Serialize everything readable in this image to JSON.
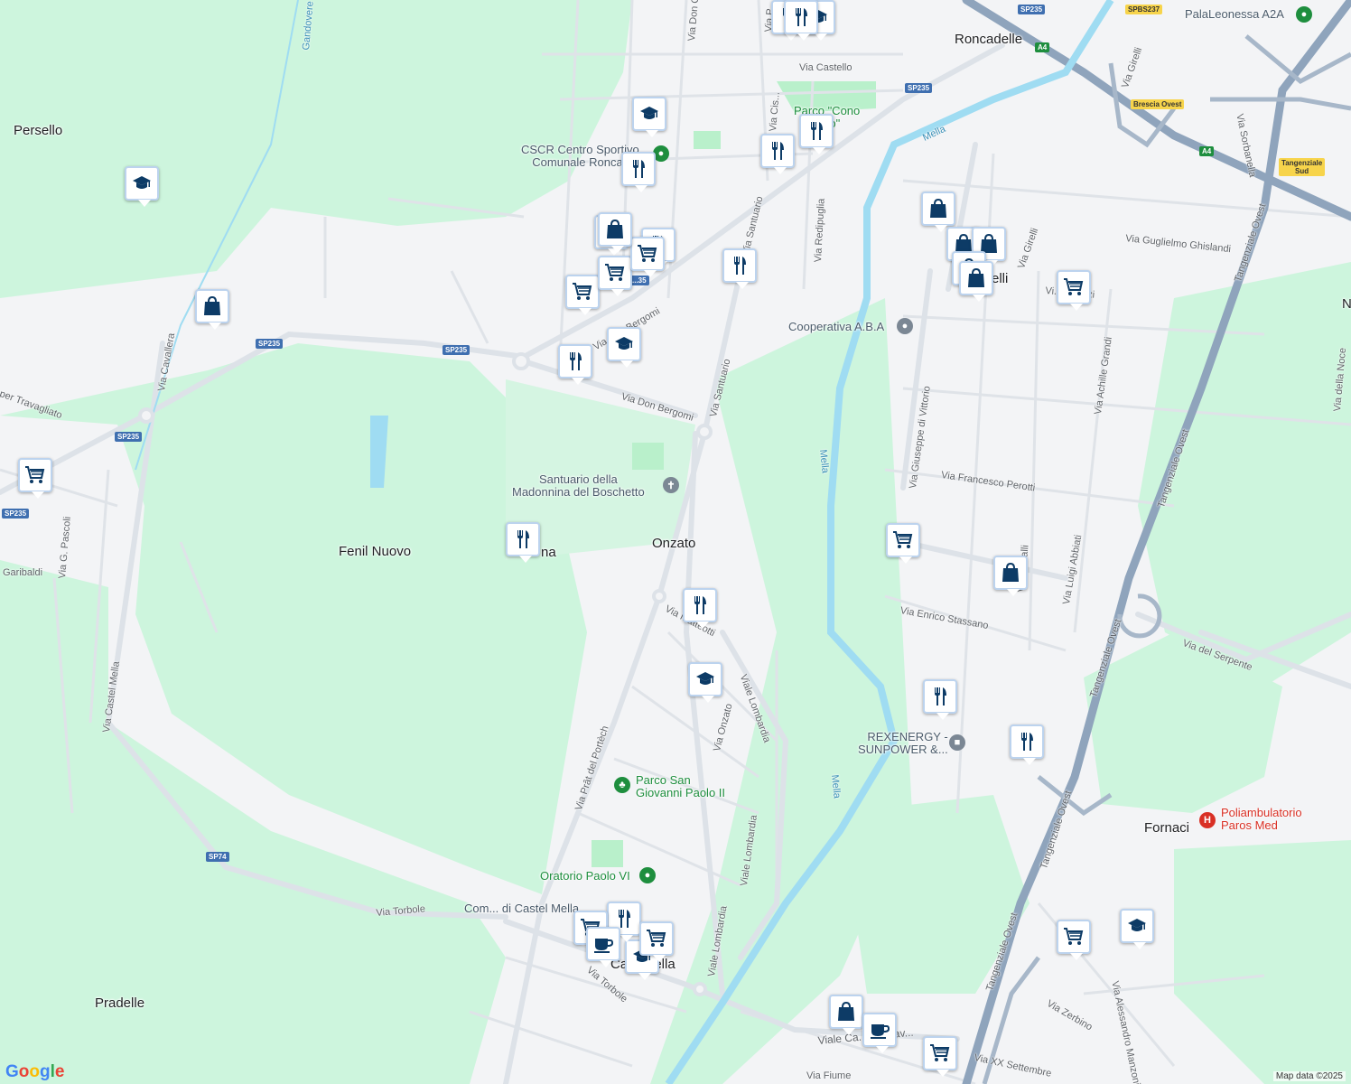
{
  "map": {
    "places": {
      "persello": "Persello",
      "fenil_nuovo": "Fenil Nuovo",
      "pradelle": "Pradelle",
      "onzato": "Onzato",
      "roncadelle": "Roncadelle",
      "fornaci": "Fornaci",
      "castel_mella": "Ca... Mella",
      "na": "na",
      "elli": "elli",
      "n": "N"
    },
    "pois": {
      "cscr": "CSCR Centro Sportivo\nComunale Roncad...",
      "parco_cono": "Parco \"Cono\n...co\"",
      "cooperativa": "Cooperativa A.B.A",
      "santuario": "Santuario della\nMadonnina del Boschetto",
      "rexenergy": "REXENERGY -\nSUNPOWER &...",
      "parco_sgp": "Parco San\nGiovanni Paolo II",
      "oratorio": "Oratorio Paolo VI",
      "comune": "Com... di Castel Mella",
      "poliambulatorio": "Poliambulatorio\nParos Med",
      "palaleonessa": "PalaLeonessa A2A"
    },
    "streets": {
      "via_don_bergomi": "Via Don Bergomi",
      "via_don_bergomi_2": "Via Don Bergomi",
      "via_santuario": "Via Santuario",
      "via_santuario_2": "Via Santuario",
      "via_castello": "Via Castello",
      "via_redipuglia": "Via Redipuglia",
      "via_cavallera": "Via Cavallera",
      "per_travagliato": "per Travagliato",
      "via_pascoli": "Via G. Pascoli",
      "garibaldi": "Garibaldi",
      "via_castel_mella": "Via Castel Mella",
      "via_prat": "Via Prât del Portèch",
      "via_matteotti": "Via Matteotti",
      "viale_lombardia": "Viale Lombardia",
      "viale_lombardia_2": "Viale Lombardia",
      "viale_lombardia_3": "Viale Lombardia",
      "via_onzato": "Via Onzato",
      "via_torbole": "Via Torbole",
      "via_torbole_2": "Via Torbole",
      "via_di_vittorio": "Via Giuseppe di Vittorio",
      "via_perotti": "Via Francesco Perotti",
      "via_stassano": "Via Enrico Stassano",
      "via_abbiati": "Via Luigi Abbiati",
      "via_grandi": "Via Achille Grandi",
      "via_girelli": "Via Girelli",
      "via_girelli_2": "Via Girelli",
      "via_ghislandi": "Via Guglielmo Ghislandi",
      "via_buozzi": "Vi... Buozzi",
      "via_serpente": "Via del Serpente",
      "tang_1": "Tangenziale Ovest",
      "tang_2": "Tangenziale Ovest",
      "tang_3": "Tangenziale Ovest",
      "tang_4": "Tangenziale Ovest",
      "tang_5": "Tangenziale Ovest",
      "via_zerbino": "Via Zerbino",
      "via_manzoni": "Via Alessandro Manzoni",
      "via_xx": "Via XX Settembre",
      "via_fiume": "Via Fiume",
      "viale_caduti": "Viale Ca... del Lav...",
      "via_sorbanella": "Via Sorbanella",
      "via_della_noce": "Via della Noce",
      "via_don_c": "Via Don C...",
      "via_cis": "Via Cis...",
      "via_cassa": "Via ...ssalli",
      "gandovere": "Gandovere",
      "mella_1": "Mella",
      "mella_2": "Mella",
      "mella_3": "Mella",
      "mella_4": "Mella",
      "via_p": "Via P..."
    },
    "shields": {
      "sp235_a": "SP235",
      "sp235_b": "SP235",
      "sp235_c": "SP235",
      "sp235_d": "SP235",
      "sp235_e": "SP235",
      "sp235_f": "SP235",
      "sp235_g": "...35",
      "spbs237": "SPBS237",
      "a4_a": "A4",
      "a4_b": "A4",
      "sp74": "SP74",
      "brescia_ovest": "Brescia Ovest",
      "tang_sud": "Tangenziale\nSud"
    },
    "attribution": "Map data ©2025",
    "logo": "Google"
  },
  "colors": {
    "green_area": "#cdf5dd",
    "river": "#9fdcf2",
    "road": "#dde2e8",
    "highway": "#8fa4bc",
    "pin_icon": "#0d3b66"
  },
  "pins": [
    {
      "icon": "education"
    },
    {
      "icon": "education"
    },
    {
      "icon": "education"
    },
    {
      "icon": "education"
    },
    {
      "icon": "education"
    },
    {
      "icon": "education"
    },
    {
      "icon": "education"
    },
    {
      "icon": "restaurant"
    },
    {
      "icon": "restaurant"
    },
    {
      "icon": "restaurant"
    },
    {
      "icon": "restaurant"
    },
    {
      "icon": "restaurant"
    },
    {
      "icon": "restaurant"
    },
    {
      "icon": "restaurant"
    },
    {
      "icon": "restaurant"
    },
    {
      "icon": "restaurant"
    },
    {
      "icon": "restaurant"
    },
    {
      "icon": "restaurant"
    },
    {
      "icon": "restaurant"
    },
    {
      "icon": "restaurant"
    },
    {
      "icon": "restaurant"
    },
    {
      "icon": "shopping-cart"
    },
    {
      "icon": "shopping-cart"
    },
    {
      "icon": "shopping-cart"
    },
    {
      "icon": "shopping-cart"
    },
    {
      "icon": "shopping-cart"
    },
    {
      "icon": "shopping-cart"
    },
    {
      "icon": "shopping-cart"
    },
    {
      "icon": "shopping-cart"
    },
    {
      "icon": "shopping-cart"
    },
    {
      "icon": "shopping-cart"
    },
    {
      "icon": "shopping-bag"
    },
    {
      "icon": "shopping-bag"
    },
    {
      "icon": "shopping-bag"
    },
    {
      "icon": "shopping-bag"
    },
    {
      "icon": "shopping-bag"
    },
    {
      "icon": "shopping-bag"
    },
    {
      "icon": "shopping-bag"
    },
    {
      "icon": "shopping-bag"
    },
    {
      "icon": "shopping-bag"
    },
    {
      "icon": "coffee-cup"
    },
    {
      "icon": "coffee-cup"
    }
  ]
}
